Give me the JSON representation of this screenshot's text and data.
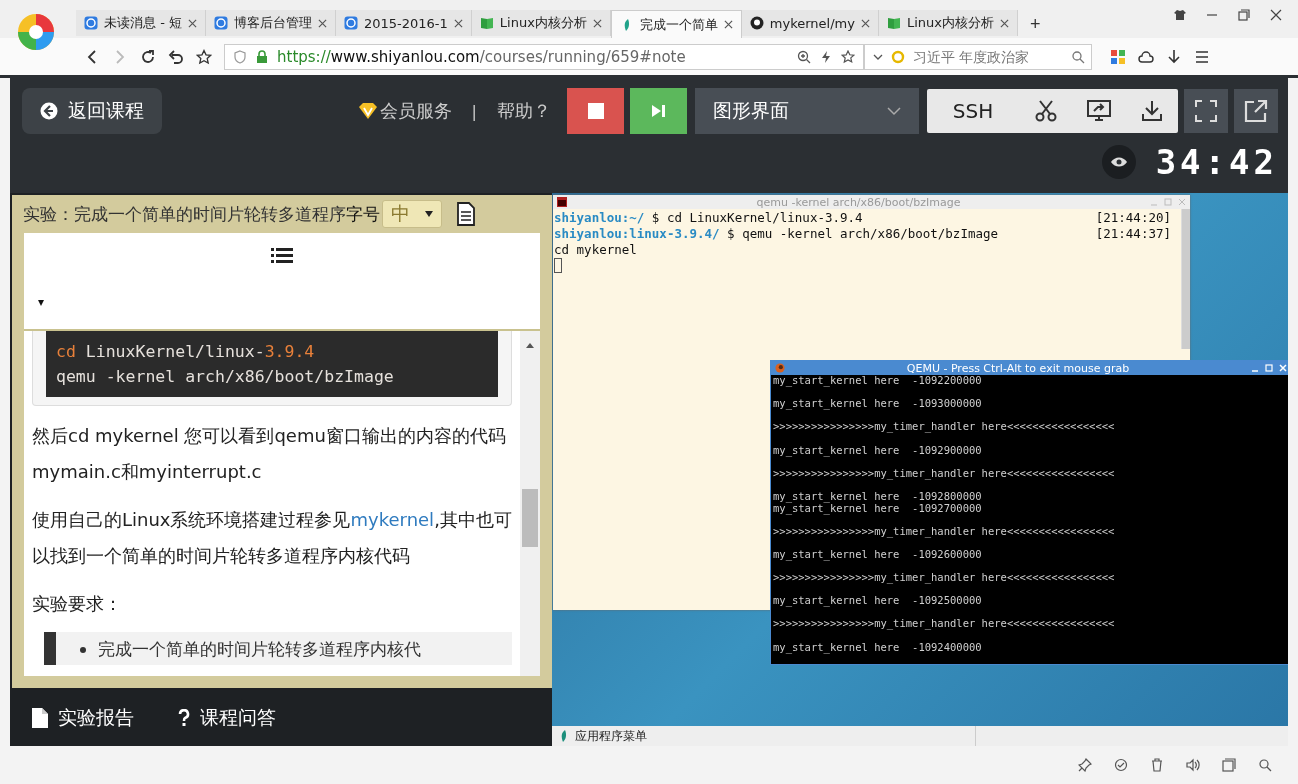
{
  "browser": {
    "tabs": [
      {
        "title": "未读消息 - 短",
        "kind": "blog",
        "selected": false
      },
      {
        "title": "博客后台管理",
        "kind": "blog",
        "selected": false
      },
      {
        "title": "2015-2016-1",
        "kind": "blog",
        "selected": false
      },
      {
        "title": "Linux内核分析",
        "kind": "book",
        "selected": false
      },
      {
        "title": "完成一个简单",
        "kind": "leaf",
        "selected": true
      },
      {
        "title": "mykernel/my",
        "kind": "github",
        "selected": false
      },
      {
        "title": "Linux内核分析",
        "kind": "book",
        "selected": false
      }
    ],
    "new_tab": "+",
    "url": {
      "scheme": "https://",
      "host": "www.shiyanlou.com",
      "path": "/courses/running/659#note"
    },
    "search": {
      "placeholder": "习近平 年度政治家"
    }
  },
  "header": {
    "back": "返回课程",
    "vip": "会员服务",
    "separator": "|",
    "help": "帮助？",
    "view_select": "图形界面",
    "tools": [
      {
        "kind": "text",
        "label": "SSH"
      },
      {
        "kind": "scissors"
      },
      {
        "kind": "screen"
      },
      {
        "kind": "download"
      }
    ],
    "timer": "34:42"
  },
  "lesson": {
    "title": "实验：完成一个简单的时间片轮转多道程序",
    "font_size_label": "字号",
    "font_size": "中",
    "toc_caret": "▾",
    "code": [
      [
        {
          "kind": "keyword",
          "text": "cd"
        },
        {
          "kind": "plain",
          "text": " LinuxKernel/linux-"
        },
        {
          "kind": "number",
          "text": "3.9.4"
        }
      ],
      [
        {
          "kind": "plain",
          "text": "qemu -kernel arch/x86/boot/bzImage"
        }
      ]
    ],
    "paragraphs": [
      [
        {
          "text": "然后cd mykernel 您可以看到qemu窗口输出的内容的代码mymain.c和myinterrupt.c",
          "kind": "text"
        }
      ],
      [
        {
          "text": "使用自己的Linux系统环境搭建过程参见",
          "kind": "text"
        },
        {
          "text": "mykernel",
          "kind": "link"
        },
        {
          "text": ",其中也可以找到一个简单的时间片轮转多道程序内核代码",
          "kind": "text"
        }
      ]
    ],
    "requirements_title": "实验要求：",
    "requirements": [
      "完成一个简单的时间片轮转多道程序内核代"
    ]
  },
  "footer_links": [
    {
      "kind": "report",
      "label": "实验报告"
    },
    {
      "kind": "question",
      "label": "课程问答"
    }
  ],
  "terminal": {
    "title": "qemu -kernel arch/x86/boot/bzImage",
    "lines": [
      {
        "kind": "prompt",
        "host": "shiyanlou:",
        "path": "~/",
        "command": "$ cd LinuxKernel/linux-3.9.4",
        "time": "[21:44:20]"
      },
      {
        "kind": "prompt",
        "host": "shiyanlou:",
        "path": "linux-3.9.4/",
        "command": "$ qemu -kernel arch/x86/boot/bzImage",
        "time": "[21:44:37]"
      },
      {
        "kind": "plain",
        "text": "cd mykernel"
      }
    ]
  },
  "qemu": {
    "title": "QEMU - Press Ctrl-Alt to exit mouse grab",
    "lines": [
      {
        "text": "my_start_kernel here  -1092200000",
        "spaced": false
      },
      {
        "text": "my_start_kernel here  -1093000000",
        "spaced": true
      },
      {
        "text": ">>>>>>>>>>>>>>>>my_timer_handler here<<<<<<<<<<<<<<<<<",
        "spaced": true
      },
      {
        "text": "my_start_kernel here  -1092900000",
        "spaced": true
      },
      {
        "text": ">>>>>>>>>>>>>>>>my_timer_handler here<<<<<<<<<<<<<<<<<",
        "spaced": true
      },
      {
        "text": "my_start_kernel here  -1092800000",
        "spaced": true
      },
      {
        "text": "my_start_kernel here  -1092700000",
        "spaced": false
      },
      {
        "text": ">>>>>>>>>>>>>>>>my_timer_handler here<<<<<<<<<<<<<<<<<",
        "spaced": true
      },
      {
        "text": "my_start_kernel here  -1092600000",
        "spaced": true
      },
      {
        "text": ">>>>>>>>>>>>>>>>my_timer_handler here<<<<<<<<<<<<<<<<<",
        "spaced": true
      },
      {
        "text": "my_start_kernel here  -1092500000",
        "spaced": true
      },
      {
        "text": ">>>>>>>>>>>>>>>>my_timer_handler here<<<<<<<<<<<<<<<<<",
        "spaced": true
      },
      {
        "text": "my_start_kernel here  -1092400000",
        "spaced": true
      }
    ]
  },
  "taskbar": {
    "menu": "应用程序菜单"
  }
}
